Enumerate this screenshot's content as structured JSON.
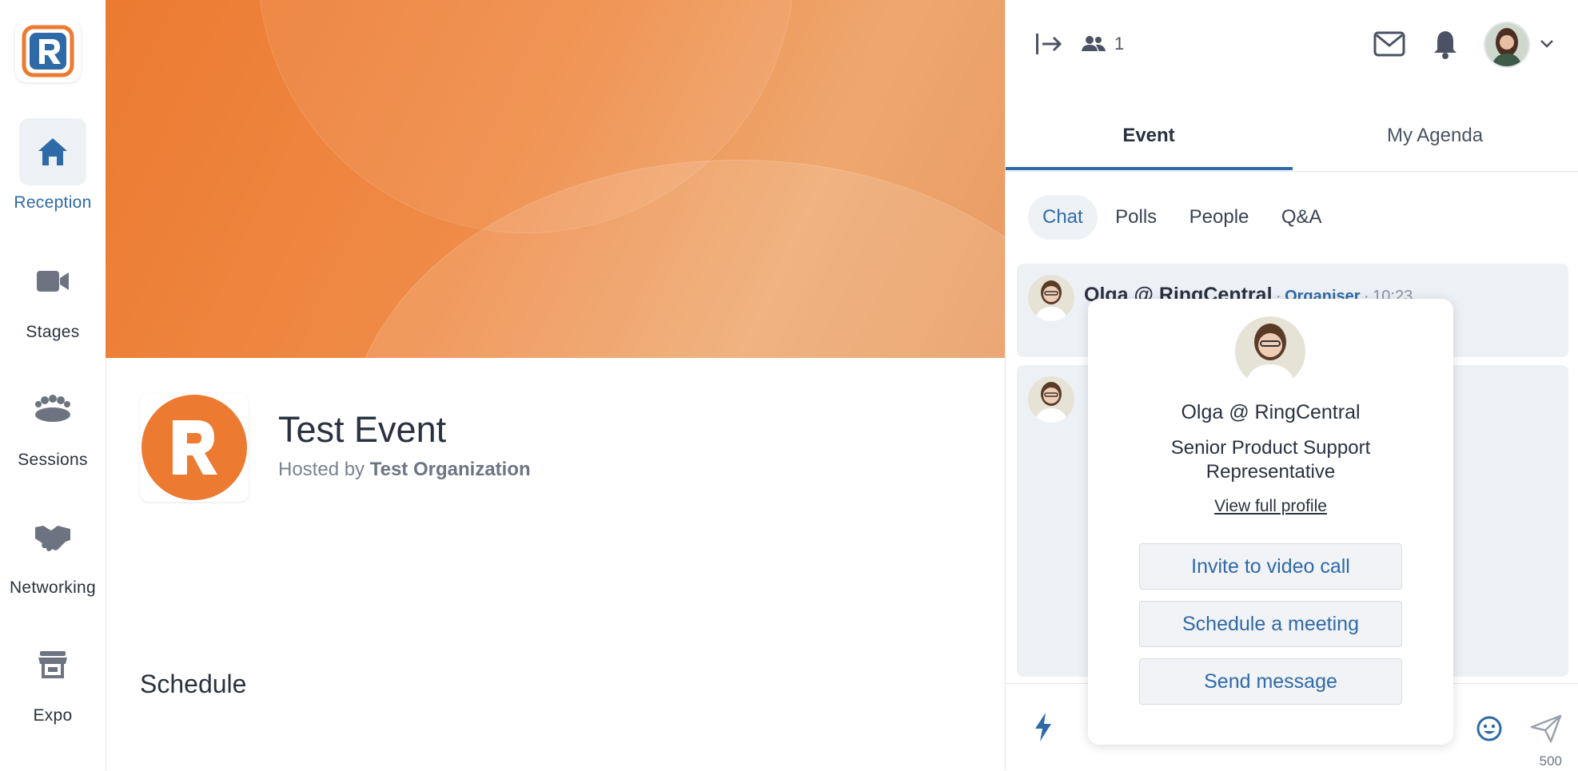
{
  "nav": {
    "items": [
      {
        "label": "Reception",
        "icon": "home-icon",
        "active": true
      },
      {
        "label": "Stages",
        "icon": "video-camera-icon",
        "active": false
      },
      {
        "label": "Sessions",
        "icon": "group-icon",
        "active": false
      },
      {
        "label": "Networking",
        "icon": "handshake-icon",
        "active": false
      },
      {
        "label": "Expo",
        "icon": "store-icon",
        "active": false
      }
    ]
  },
  "event": {
    "title": "Test Event",
    "hosted_prefix": "Hosted by",
    "organization": "Test Organization",
    "schedule_heading": "Schedule"
  },
  "topbar": {
    "attendee_count": "1"
  },
  "tabs": {
    "main": [
      "Event",
      "My Agenda"
    ],
    "sub": [
      "Chat",
      "Polls",
      "People",
      "Q&A"
    ]
  },
  "chat": {
    "message": {
      "author": "Olga @ RingCentral",
      "role": "Organiser",
      "separator": "·",
      "time": "10:23"
    },
    "char_limit": "500"
  },
  "popover": {
    "name": "Olga @ RingCentral",
    "title": "Senior Product Support Representative",
    "view_profile": "View full profile",
    "buttons": {
      "invite": "Invite to video call",
      "schedule": "Schedule a meeting",
      "message": "Send message"
    }
  },
  "colors": {
    "brand_orange": "#ec7a31",
    "accent_blue": "#2f6aa8",
    "panel_bg": "#edf1f6"
  }
}
